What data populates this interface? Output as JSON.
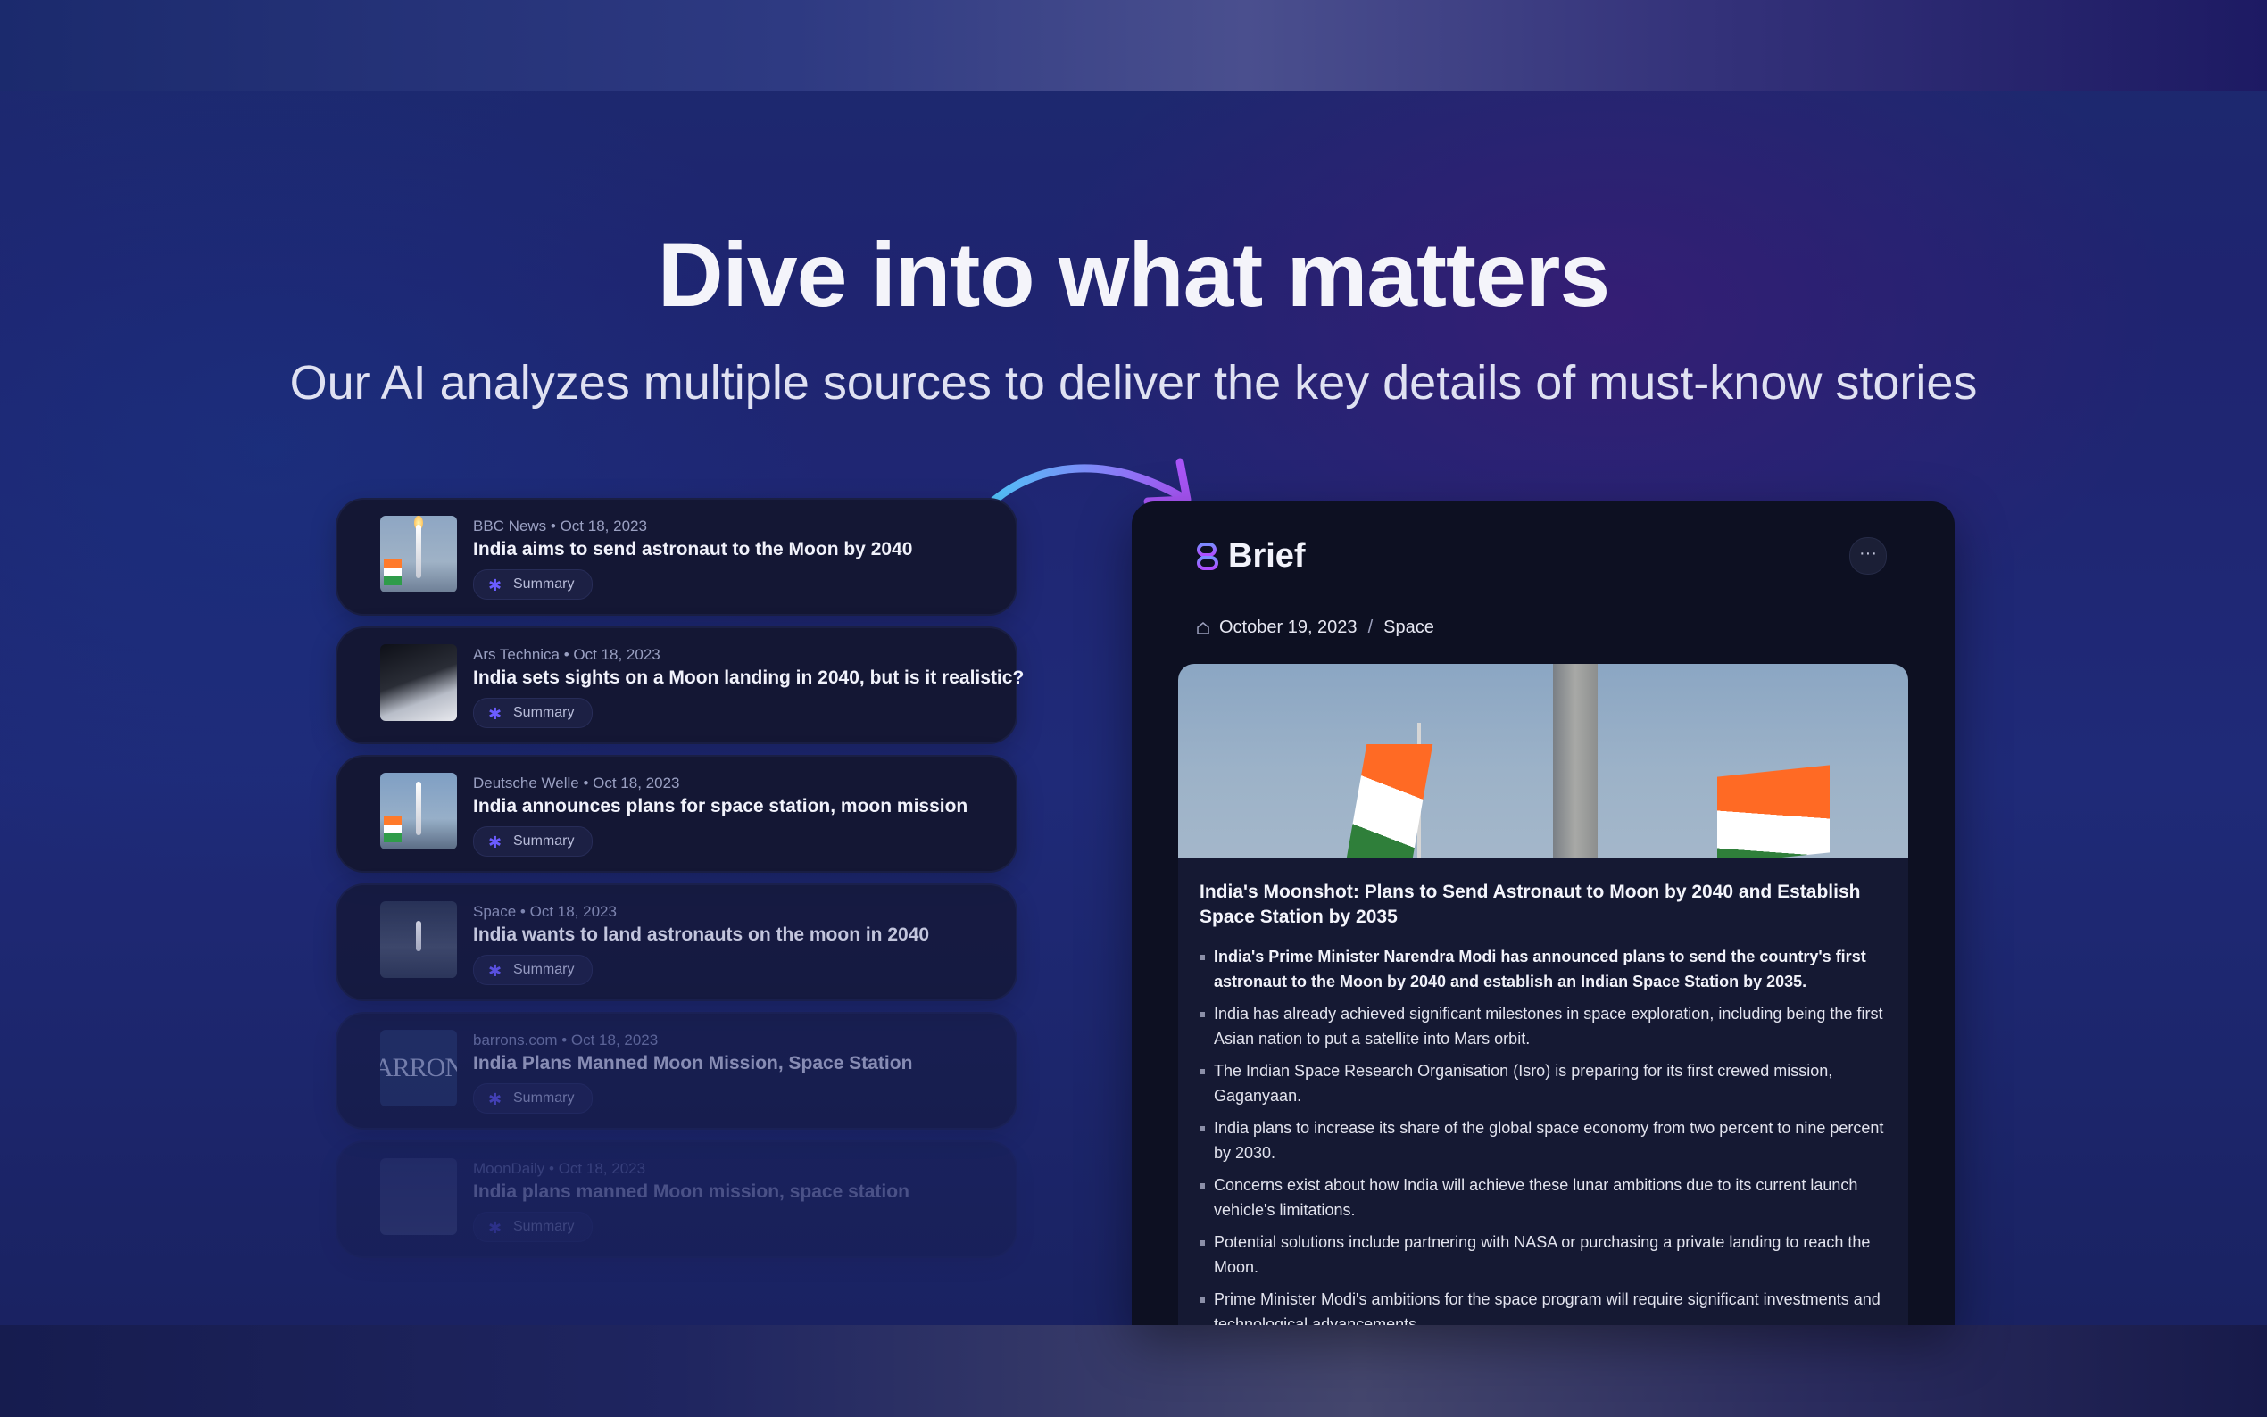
{
  "hero": {
    "title": "Dive into what matters",
    "subtitle": "Our AI analyzes multiple sources to deliver the key details of must-know stories"
  },
  "feed": {
    "items": [
      {
        "source": "BBC News • Oct 18, 2023",
        "title": "India aims to send astronaut to the Moon by 2040",
        "button": "Summary",
        "thumb": "rocket-launch-photo"
      },
      {
        "source": "Ars Technica • Oct 18, 2023",
        "title": "India sets sights on a Moon landing in 2040, but is it realistic?",
        "button": "Summary",
        "thumb": "moon-surface-photo"
      },
      {
        "source": "Deutsche Welle • Oct 18, 2023",
        "title": "India announces plans for space station, moon mission",
        "button": "Summary",
        "thumb": "rocket-with-flags-photo"
      },
      {
        "source": "Space • Oct 18, 2023",
        "title": "India wants to land astronauts on the moon in 2040",
        "button": "Summary",
        "thumb": "rocket-night-photo"
      },
      {
        "source": "barrons.com • Oct 18, 2023",
        "title": "India Plans Manned Moon Mission, Space Station",
        "button": "Summary",
        "thumb_text": "ARRON"
      },
      {
        "source": "MoonDaily • Oct 18, 2023",
        "title": "India plans manned Moon mission, space station",
        "button": "Summary",
        "thumb": "moon-photo"
      }
    ]
  },
  "brief": {
    "brand": "Brief",
    "more": "···",
    "date": "October 19, 2023",
    "separator": "/",
    "category": "Space",
    "headline": "India's Moonshot: Plans to Send Astronaut to Moon by 2040 and Establish Space Station by 2035",
    "bullets": [
      "India's Prime Minister Narendra Modi has announced plans to send the country's first astronaut to the Moon by 2040 and establish an Indian Space Station by 2035.",
      "India has already achieved significant milestones in space exploration, including being the first Asian nation to put a satellite into Mars orbit.",
      "The Indian Space Research Organisation (Isro) is preparing for its first crewed mission, Gaganyaan.",
      "India plans to increase its share of the global space economy from two percent to nine percent by 2030.",
      "Concerns exist about how India will achieve these lunar ambitions due to its current launch vehicle's limitations.",
      "Potential solutions include partnering with NASA or purchasing a private landing to reach the Moon.",
      "Prime Minister Modi's ambitions for the space program will require significant investments and technological advancements."
    ]
  },
  "colors": {
    "accent": "#6b5cff",
    "panel": "#0d1022",
    "card": "#141734"
  }
}
